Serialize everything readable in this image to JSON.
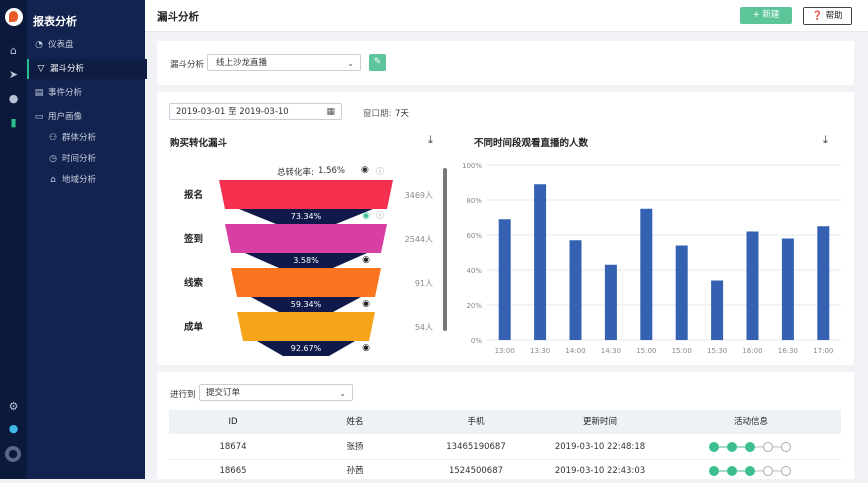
{
  "sidebar": {
    "title": "报表分析",
    "items": [
      {
        "icon": "gauge-icon",
        "label": "仪表盘"
      },
      {
        "icon": "funnel-icon",
        "label": "漏斗分析"
      },
      {
        "icon": "event-icon",
        "label": "事件分析"
      },
      {
        "icon": "folder-icon",
        "label": "用户画像"
      },
      {
        "icon": "group-icon",
        "label": "群体分析"
      },
      {
        "icon": "clock-icon",
        "label": "时间分析"
      },
      {
        "icon": "map-icon",
        "label": "地域分析"
      }
    ]
  },
  "topbar": {
    "title": "漏斗分析",
    "new_label": "+ 新建",
    "help_label": "帮助"
  },
  "filter": {
    "label": "漏斗分析",
    "selected": "线上沙龙直播"
  },
  "date": {
    "range": "2019-03-01 至 2019-03-10",
    "window_label": "窗口期:",
    "window_value": "7天"
  },
  "funnel": {
    "title": "购买转化漏斗",
    "total_label": "总转化率:",
    "total_value": "1.56%",
    "stages": [
      {
        "name": "报名",
        "count": "3469人",
        "color": "#f5304f"
      },
      {
        "name": "签到",
        "count": "2544人",
        "color": "#d83fa3"
      },
      {
        "name": "线索",
        "count": "91人",
        "color": "#fb7420"
      },
      {
        "name": "成单",
        "count": "54人",
        "color": "#f6a51b"
      }
    ],
    "rates": [
      "73.34%",
      "3.58%",
      "59.34%",
      "92.67%"
    ]
  },
  "chart_data": {
    "type": "bar",
    "title": "不同时间段观看直播的人数",
    "categories": [
      "13:00",
      "13:30",
      "14:00",
      "14:30",
      "15:00",
      "15:00",
      "15:30",
      "16:00",
      "16:30",
      "17:00"
    ],
    "values": [
      69,
      89,
      57,
      43,
      75,
      54,
      34,
      62,
      58,
      65
    ],
    "ylim": [
      0,
      100
    ],
    "yticks": [
      "0%",
      "20%",
      "40%",
      "60%",
      "80%",
      "100%"
    ],
    "color": "#3461b1",
    "grid": true
  },
  "table": {
    "progress_label": "进行到",
    "progress_selected": "提交订单",
    "columns": [
      "ID",
      "姓名",
      "手机",
      "更新时间",
      "活动信息"
    ],
    "rows": [
      {
        "id": "18674",
        "name": "张扬",
        "phone": "13465190687",
        "time": "2019-03-10 22:48:18",
        "steps_done": 3,
        "steps_total": 5
      },
      {
        "id": "18665",
        "name": "孙茜",
        "phone": "1524500687",
        "time": "2019-03-10 22:43:03",
        "steps_done": 3,
        "steps_total": 5
      }
    ]
  },
  "colors": {
    "accent": "#5cc69a",
    "sidebar": "#132350",
    "rail": "#0b1a3c",
    "bar": "#3461b1",
    "funnel_gap": "#0f1a4a"
  }
}
